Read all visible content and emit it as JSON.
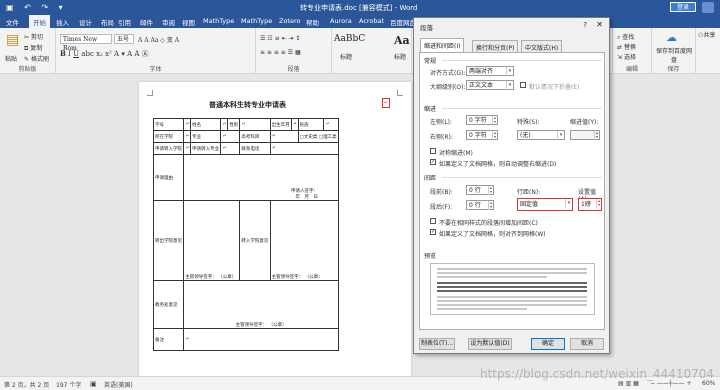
{
  "window": {
    "title": "转专业申请表.doc [兼容模式] - Word",
    "login_label": "登录"
  },
  "ribbon": {
    "tabs": [
      "文件",
      "开始",
      "插入",
      "设计",
      "布局",
      "引用",
      "邮件",
      "审阅",
      "视图",
      "MathType",
      "MathType",
      "Zotero",
      "帮助",
      "Aurora",
      "Acrobat",
      "百度网盘"
    ],
    "active_tab": "开始",
    "clipboard": {
      "cut": "剪切",
      "copy": "复制",
      "painter": "格式刷",
      "paste": "粘贴",
      "label": "剪贴板"
    },
    "font": {
      "name": "Times New Rom",
      "size": "五号",
      "label": "字体"
    },
    "paragraph": {
      "label": "段落"
    },
    "styles": {
      "s1": "AaBbC",
      "s2": "Aa",
      "s1_name": "标题",
      "s2_name": "标题"
    },
    "editing": {
      "find": "查找",
      "replace": "替换",
      "select": "选择",
      "label": "编辑"
    },
    "baidu": {
      "save": "保存到百度网盘",
      "label": "保存"
    },
    "share": "共享"
  },
  "document": {
    "title": "普通本科生转专业申请表",
    "form": {
      "rows": [
        [
          "学号",
          "",
          "姓名",
          "",
          "性别",
          "",
          "出生年月",
          "",
          "民族",
          ""
        ],
        [
          "所在学院",
          "",
          "专业",
          "",
          "",
          "高考科目",
          "",
          "□文史类 □理工类"
        ],
        [
          "申请转入学院",
          "",
          "申请转入专业",
          "",
          "",
          "联系电话",
          ""
        ]
      ],
      "reason_label": "申请理由",
      "signature_line": "申请人签字：",
      "date_line": "年　月　日",
      "opinion_a": "转出学院意见",
      "opinion_b": "转入学院意见",
      "dean_sig": "主管领导签字：",
      "seal": "（公章）",
      "academic_label": "教务处意见",
      "footer_note": "备注"
    }
  },
  "dialog": {
    "title": "段落",
    "help": "?",
    "tabs": [
      "缩进和间距(I)",
      "换行和分页(P)",
      "中文版式(H)"
    ],
    "active_tab": "缩进和间距(I)",
    "general": {
      "section": "常规",
      "align_label": "对齐方式(G):",
      "align_value": "两端对齐",
      "outline_label": "大纲级别(O):",
      "outline_value": "正文文本",
      "collapse_label": "默认情况下折叠(E)"
    },
    "indent": {
      "section": "缩进",
      "left_label": "左侧(L):",
      "left_value": "0 字符",
      "right_label": "右侧(R):",
      "right_value": "0 字符",
      "special_label": "特殊(S):",
      "special_value": "(无)",
      "by_label": "缩进值(Y):",
      "by_value": "",
      "mirror_label": "对称缩进(M)",
      "grid_label": "如果定义了文档网格，则自动调整右缩进(D)"
    },
    "spacing": {
      "section": "间距",
      "before_label": "段前(B):",
      "before_value": "0 行",
      "after_label": "段后(F):",
      "after_value": "0 行",
      "line_label": "行距(N):",
      "line_value": "固定值",
      "at_label": "设置值(A):",
      "at_value": "1磅",
      "no_space_label": "不要在相同样式的段落间增加间距(C)",
      "snap_label": "如果定义了文档网格，则对齐到网格(W)"
    },
    "preview_label": "预览",
    "buttons": {
      "tabs": "制表位(T)...",
      "default": "设为默认值(D)",
      "ok": "确定",
      "cancel": "取消"
    }
  },
  "statusbar": {
    "page": "第 2 页，共 2 页",
    "words": "197 个字",
    "lang": "英语(美国)",
    "zoom": "60%"
  },
  "watermark": "https://blog.csdn.net/weixin_44410704"
}
